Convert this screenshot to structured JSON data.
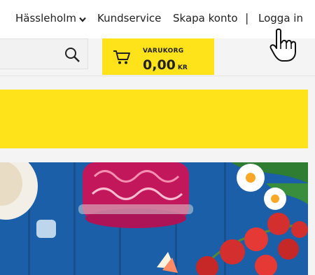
{
  "header": {
    "store_location": "Hässleholm",
    "customer_service": "Kundservice",
    "create_account": "Skapa konto",
    "separator": "|",
    "login": "Logga in"
  },
  "search": {
    "icon": "search-icon"
  },
  "cart": {
    "label": "VARUKORG",
    "amount": "0,00",
    "currency": "KR",
    "icon": "shopping-cart-icon"
  },
  "colors": {
    "accent_yellow": "#ffe31a",
    "hero_blue": "#1b5fa8"
  }
}
